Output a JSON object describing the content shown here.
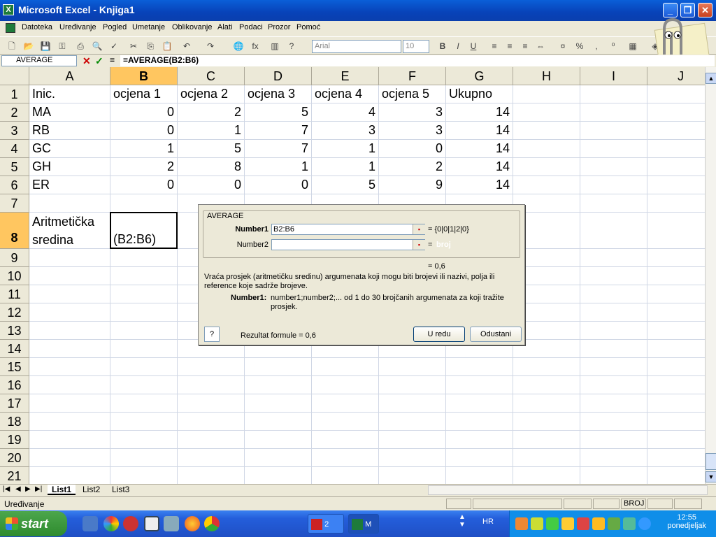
{
  "window": {
    "title": "Microsoft Excel - Knjiga1"
  },
  "menu": [
    "Datoteka",
    "Uređivanje",
    "Pogled",
    "Umetanje",
    "Oblikovanje",
    "Alati",
    "Podaci",
    "Prozor",
    "Pomoć"
  ],
  "toolbar": {
    "font": "Arial",
    "size": "10"
  },
  "formula_bar": {
    "name_box": "AVERAGE",
    "formula": "=AVERAGE(B2:B6)"
  },
  "columns": [
    "A",
    "B",
    "C",
    "D",
    "E",
    "F",
    "G",
    "H",
    "I",
    "J"
  ],
  "rows": [
    "1",
    "2",
    "3",
    "4",
    "5",
    "6",
    "7",
    "8",
    "9",
    "10",
    "11",
    "12",
    "13",
    "14",
    "15",
    "16",
    "17",
    "18",
    "19",
    "20",
    "21"
  ],
  "cells": {
    "r1": [
      "Inic.",
      "ocjena 1",
      "ocjena 2",
      "ocjena 3",
      "ocjena 4",
      "ocjena 5",
      "Ukupno"
    ],
    "r2": [
      "MA",
      "0",
      "2",
      "5",
      "4",
      "3",
      "14"
    ],
    "r3": [
      "RB",
      "0",
      "1",
      "7",
      "3",
      "3",
      "14"
    ],
    "r4": [
      "GC",
      "1",
      "5",
      "7",
      "1",
      "0",
      "14"
    ],
    "r5": [
      "GH",
      "2",
      "8",
      "1",
      "1",
      "2",
      "14"
    ],
    "r6": [
      "ER",
      "0",
      "0",
      "0",
      "5",
      "9",
      "14"
    ],
    "a8_line1": "Aritmetička",
    "a8_line2": "sredina",
    "b8": "(B2:B6)"
  },
  "dialog": {
    "legend": "AVERAGE",
    "number1_label": "Number1",
    "number1_value": "B2:B6",
    "number1_result": "= {0|0|1|2|0}",
    "number2_label": "Number2",
    "number2_value": "",
    "number2_result": "=",
    "number2_hint": "broj",
    "overall_result": "= 0,6",
    "description": "Vraća prosjek (aritmetičku sredinu) argumenata koji mogu biti brojevi ili nazivi, polja ili reference koje sadrže brojeve.",
    "arg_name": "Number1:",
    "arg_desc": "number1;number2;... od 1 do 30 brojčanih argumenata za koji tražite prosjek.",
    "formula_result": "Rezultat formule =  0,6",
    "help_label": "?",
    "ok_label": "U redu",
    "cancel_label": "Odustani"
  },
  "sheets": [
    "List1",
    "List2",
    "List3"
  ],
  "status": {
    "mode": "Uređivanje",
    "num": "BROJ"
  },
  "taskbar": {
    "start": "start",
    "task1": "2",
    "task2": "M",
    "lang": "HR",
    "time": "12:55",
    "day": "ponedjeljak"
  }
}
